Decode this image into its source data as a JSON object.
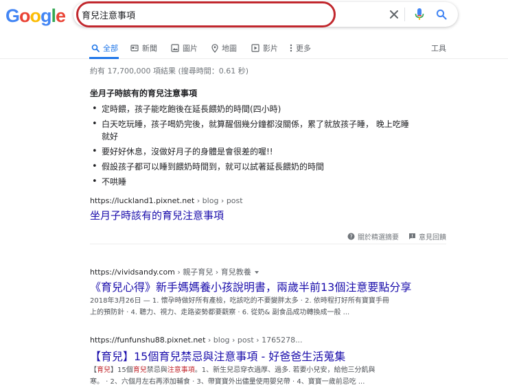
{
  "logo": {
    "letters": [
      "G",
      "o",
      "o",
      "g",
      "l",
      "e"
    ],
    "colors": [
      "#4285f4",
      "#ea4335",
      "#fbbc05",
      "#4285f4",
      "#34a853",
      "#ea4335"
    ]
  },
  "search": {
    "query": "育兒注意事項"
  },
  "icons": {
    "clear": "close-icon",
    "voice": "microphone-icon",
    "search": "search-icon"
  },
  "tabs": [
    {
      "label": "全部",
      "icon": "search-icon"
    },
    {
      "label": "新聞",
      "icon": "newspaper-icon"
    },
    {
      "label": "圖片",
      "icon": "image-icon"
    },
    {
      "label": "地圖",
      "icon": "map-pin-icon"
    },
    {
      "label": "影片",
      "icon": "video-icon"
    },
    {
      "label": "更多",
      "icon": "more-vertical-icon"
    }
  ],
  "tools_label": "工具",
  "stats": "約有 17,700,000 項結果 (搜尋時間：0.61 秒)",
  "featured": {
    "heading": "坐月子時該有的育兒注意事項",
    "bullets": [
      "定時餵，孩子能吃飽後在延長餵奶的時間(四小時)",
      "白天吃玩睡，孩子喝奶完後，就算醒個幾分鐘都沒關係，累了就放孩子睡， 晚上吃睡",
      "就好",
      "要好好休息，沒做好月子的身體是會很差的喔!!",
      "假設孩子都可以睡到餵奶時間到，就可以試著延長餵奶的時間",
      "不哄睡"
    ],
    "url_domain": "https://luckland1.pixnet.net",
    "url_path": " › blog › post",
    "title": "坐月子時該有的育兒注意事項",
    "feedback_about": "關於精選摘要",
    "feedback_report": "意見回饋"
  },
  "results": [
    {
      "url_domain": "https://vividsandy.com",
      "url_path": " › 親子育兒 › 育兒教養",
      "title": "《育兒心得》新手媽媽養小孩說明書，兩歲半前13個注意要點分享",
      "desc_line1": "2018年3月26日 — 1. 懷孕時做好所有產檢，吃該吃的不要變胖太多 · 2. 依時程打好所有寶寶手冊",
      "desc_line2": "上的預防針 · 4. 聽力、視力、走路姿勢都要觀察 · 6. 從奶& 副食品成功轉換成一般 ..."
    },
    {
      "url_domain": "https://funfunshu88.pixnet.net",
      "url_path": " › blog › post › 1765278...",
      "title": "【育兒】15個育兒禁忌與注意事項 - 好爸爸生活蒐集",
      "desc_p1": "【",
      "desc_h1": "育兒",
      "desc_p2": "】15個",
      "desc_h2": "育兒",
      "desc_p3": "禁忌與",
      "desc_h3": "注意事項",
      "desc_p4": "。1、新生兒忌穿衣過厚、過多. 若要小兒安，給他三分飢與",
      "desc_line2": "寒。 · 2、六個月左右再添加輔食 · 3、帶寶寶外出儘量使用嬰兒帶 · 4、寶寶一歲前忌吃 ..."
    }
  ]
}
